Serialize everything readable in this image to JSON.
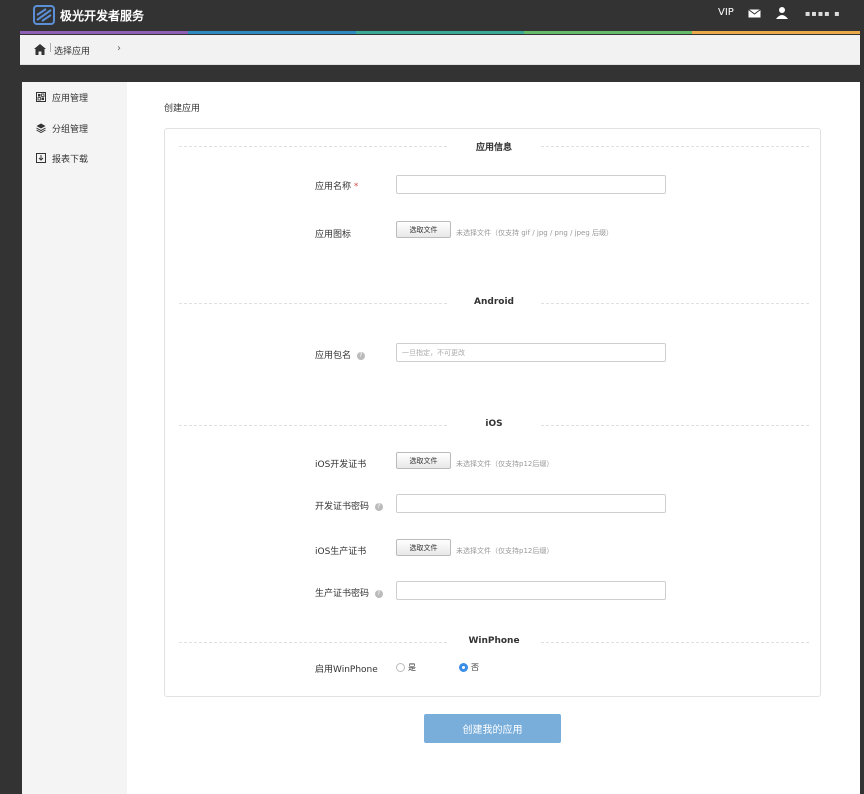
{
  "header": {
    "app_title": "极光开发者服务",
    "vip_label": "VIP",
    "username": "▪▪▪▪ ▪",
    "accent_colors": [
      "#8e5fb5",
      "#2e8bc0",
      "#3aaa97",
      "#66bb6a",
      "#eaa94a"
    ]
  },
  "breadcrumb": {
    "separator": "|",
    "label": "选择应用",
    "arrow": "›"
  },
  "sidebar": {
    "items": [
      {
        "label": "应用管理",
        "icon": "app-grid-icon"
      },
      {
        "label": "分组管理",
        "icon": "layers-icon"
      },
      {
        "label": "报表下载",
        "icon": "download-icon"
      }
    ]
  },
  "main": {
    "page_title": "创建应用",
    "sections": {
      "app_info": "应用信息",
      "android": "Android",
      "ios": "iOS",
      "winphone": "WinPhone"
    },
    "fields": {
      "app_name_label": "应用名称",
      "required_mark": "*",
      "app_name_value": "",
      "app_icon_label": "应用图标",
      "file_button": "选取文件",
      "app_icon_hint": "未选择文件（仅支持 gif / jpg / png / jpeg 后缀）",
      "package_label": "应用包名",
      "package_placeholder": "一旦指定，不可更改",
      "help_glyph": "?",
      "ios_dev_cert_label": "iOS开发证书",
      "ios_dev_cert_hint": "未选择文件（仅支持p12后缀）",
      "dev_cert_pwd_label": "开发证书密码",
      "ios_prod_cert_label": "iOS生产证书",
      "ios_prod_cert_hint": "未选择文件（仅支持p12后缀）",
      "prod_cert_pwd_label": "生产证书密码",
      "winphone_label": "启用WinPhone",
      "winphone_yes": "是",
      "winphone_no": "否",
      "winphone_selected": "否"
    },
    "submit_label": "创建我的应用"
  }
}
